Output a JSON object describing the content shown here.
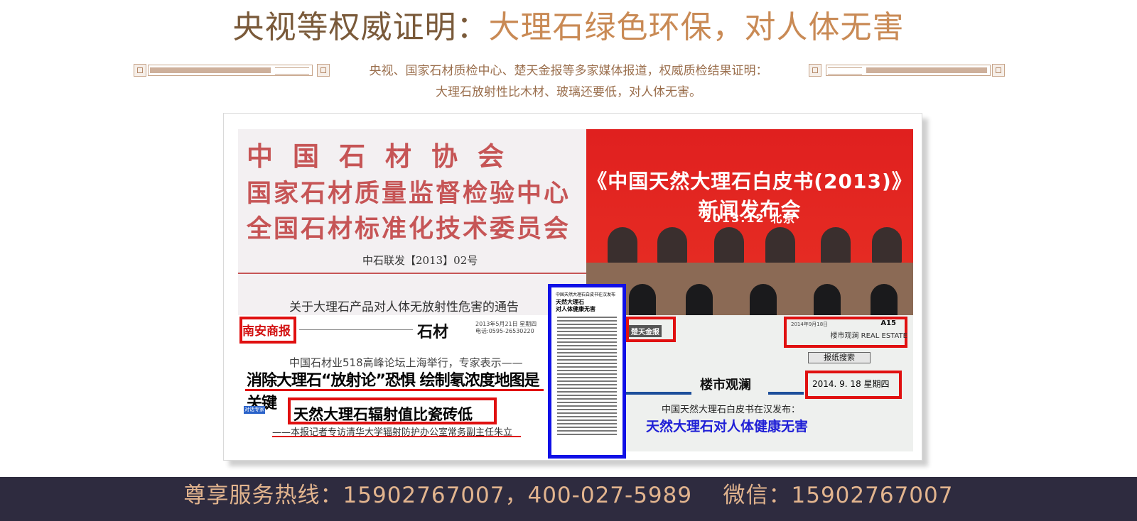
{
  "heading": {
    "part1": "央视等权威证明：",
    "part2": "大理石绿色环保，对人体无害"
  },
  "intro": {
    "line1": "央视、国家石材质检中心、楚天金报等多家媒体报道，权威质检结果证明：",
    "line2": "大理石放射性比木材、玻璃还要低，对人体无害。"
  },
  "evidence": {
    "document": {
      "line1": "中国石材协会",
      "line2": "国家石材质量监督检验中心",
      "line3": "全国石材标准化技术委员会",
      "number": "中石联发【2013】02号",
      "notice": "关于大理石产品对人体无放射性危害的通告"
    },
    "photo": {
      "banner": "《中国天然大理石白皮书(2013)》新闻发布会",
      "date": "2013.12  北京"
    },
    "newspaper1": {
      "paper_name": "南安商报",
      "section": "石材",
      "issue": "2013年5月21日 星期四",
      "phone": "电话:0595-26530220",
      "teaser": "中国石材业518高峰论坛上海举行，专家表示——",
      "headline_big": "消除大理石“放射论”恐惧  绘制氡浓度地图是关键",
      "tag": "对话专家",
      "headline": "天然大理石辐射值比瓷砖低",
      "byline": "——本报记者专访清华大学辐射防护办公室常务副主任朱立"
    },
    "column": {
      "kicker": "中国天然大理石白皮书在汉发布",
      "title1": "天然大理石",
      "title2": "对人体健康无害"
    },
    "newspaper2": {
      "paper_name": "楚天金报",
      "issue": "2014年9月18日",
      "page": "A15",
      "real_estate": "楼市观澜  REAL ESTATE",
      "search_button": "报纸搜索",
      "section": "楼市观澜",
      "date": "2014. 9. 18  星期四",
      "kicker": "中国天然大理石白皮书在汉发布：",
      "headline": "天然大理石对人体健康无害"
    }
  },
  "footer": {
    "text": "尊享服务热线：15902767007，400-027-5989    微信：15902767007"
  },
  "colors": {
    "title_dark": "#7a5a3a",
    "title_accent": "#c98a55",
    "footer_bg": "#2e2b3f",
    "footer_text": "#e2b48e",
    "highlight_red": "#e01010",
    "highlight_blue": "#1010e6"
  }
}
